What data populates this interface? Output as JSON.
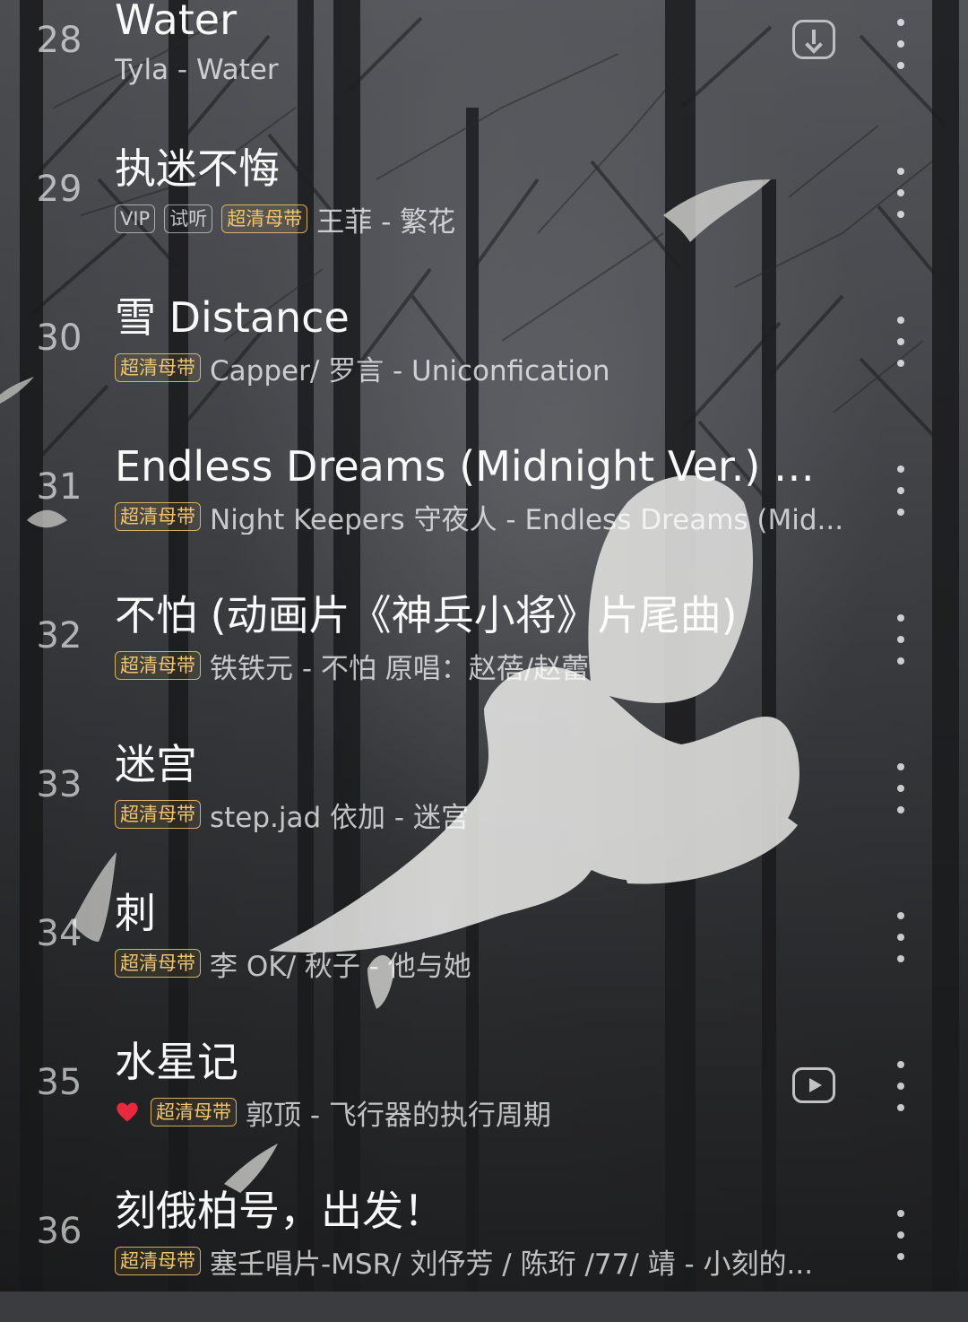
{
  "songs": [
    {
      "index": "28",
      "title": "Water",
      "tags": [],
      "artist": "Tyla - Water",
      "liked": false,
      "action_icon": "download-icon"
    },
    {
      "index": "29",
      "title": "执迷不悔",
      "tags": [
        {
          "label": "VIP",
          "style": "grey"
        },
        {
          "label": "试听",
          "style": "grey"
        },
        {
          "label": "超清母带",
          "style": "gold"
        }
      ],
      "artist": "王菲 - 繁花",
      "liked": false,
      "action_icon": ""
    },
    {
      "index": "30",
      "title": "雪 Distance",
      "tags": [
        {
          "label": "超清母带",
          "style": "gold"
        }
      ],
      "artist": "Capper/ 罗言 - Uniconfication",
      "liked": false,
      "action_icon": ""
    },
    {
      "index": "31",
      "title": "Endless Dreams (Midnight Ver.) (雷…",
      "tags": [
        {
          "label": "超清母带",
          "style": "gold"
        }
      ],
      "artist": "Night Keepers 守夜人 - Endless Dreams (Mid...",
      "liked": false,
      "action_icon": ""
    },
    {
      "index": "32",
      "title": "不怕 (动画片《神兵小将》片尾曲)",
      "tags": [
        {
          "label": "超清母带",
          "style": "gold"
        }
      ],
      "artist": "铁铁元 - 不怕   原唱：赵蓓/赵蕾",
      "liked": false,
      "action_icon": ""
    },
    {
      "index": "33",
      "title": "迷宫",
      "tags": [
        {
          "label": "超清母带",
          "style": "gold"
        }
      ],
      "artist": "step.jad 依加 - 迷宫",
      "liked": false,
      "action_icon": ""
    },
    {
      "index": "34",
      "title": "刺",
      "tags": [
        {
          "label": "超清母带",
          "style": "gold"
        }
      ],
      "artist": "李 OK/ 秋子 - 他与她",
      "liked": false,
      "action_icon": ""
    },
    {
      "index": "35",
      "title": "水星记",
      "tags": [
        {
          "label": "超清母带",
          "style": "gold"
        }
      ],
      "artist": "郭顶 - 飞行器的执行周期",
      "liked": true,
      "action_icon": "mv-play-icon"
    },
    {
      "index": "36",
      "title": "刻俄柏号，出发！",
      "tags": [
        {
          "label": "超清母带",
          "style": "gold"
        }
      ],
      "artist": "塞壬唱片-MSR/ 刘伃芳 / 陈珩 /77/ 靖 - 小刻的...",
      "liked": false,
      "action_icon": ""
    }
  ],
  "colors": {
    "tag_gold": "#f1c46a",
    "heart_red": "#e8283c"
  }
}
